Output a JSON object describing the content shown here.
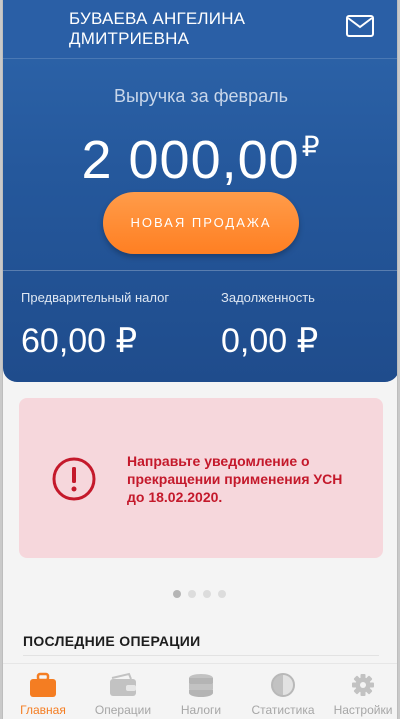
{
  "header": {
    "user_name": "БУВАЕВА АНГЕЛИНА ДМИТРИЕВНА",
    "mail_icon": "mail-icon"
  },
  "revenue": {
    "label": "Выручка за февраль",
    "amount": "2 000,00",
    "currency": "₽"
  },
  "new_sale_button": "НОВАЯ ПРОДАЖА",
  "stats": {
    "prepaid_tax_label": "Предварительный налог",
    "prepaid_tax_value": "60,00 ₽",
    "debt_label": "Задолженность",
    "debt_value": "0,00 ₽"
  },
  "notification": {
    "icon": "alert-icon",
    "text": "Направьте уведомление о прекращении применения УСН до 18.02.2020."
  },
  "carousel": {
    "total": 4,
    "active_index": 0
  },
  "recent_operations": {
    "title": "ПОСЛЕДНИЕ ОПЕРАЦИИ"
  },
  "tabbar": {
    "items": [
      {
        "label": "Главная",
        "icon": "briefcase-icon",
        "active": true
      },
      {
        "label": "Операции",
        "icon": "wallet-icon",
        "active": false
      },
      {
        "label": "Налоги",
        "icon": "coins-icon",
        "active": false
      },
      {
        "label": "Статистика",
        "icon": "pie-chart-icon",
        "active": false
      },
      {
        "label": "Настройки",
        "icon": "gear-icon",
        "active": false
      }
    ]
  },
  "colors": {
    "header_blue": "#25589c",
    "accent_orange": "#ff8a30",
    "alert_red": "#c4192b",
    "alert_bg": "#f6d7dc"
  }
}
